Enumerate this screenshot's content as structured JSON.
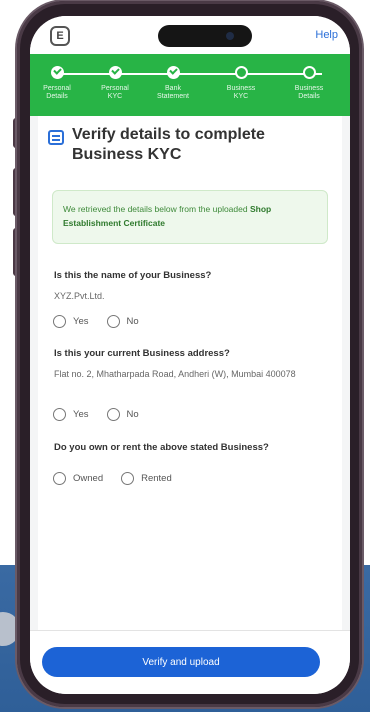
{
  "header": {
    "help_label": "Help",
    "doc_icon": "document-icon"
  },
  "progress": {
    "steps": [
      {
        "label": "Personal\nDetails",
        "status": "done"
      },
      {
        "label": "Personal\nKYC",
        "status": "done"
      },
      {
        "label": "Bank\nStatement",
        "status": "done"
      },
      {
        "label": "Business\nKYC",
        "status": "pending"
      },
      {
        "label": "Business\nDetails",
        "status": "pending"
      }
    ]
  },
  "main": {
    "title": "Verify details to complete Business KYC",
    "info_text": "We retrieved the details below from the uploaded ",
    "info_bold": "Shop Establishment Certificate",
    "questions": [
      {
        "question": "Is this the name of your Business?",
        "answer": "XYZ.Pvt.Ltd.",
        "options": [
          "Yes",
          "No"
        ]
      },
      {
        "question": "Is this your current Business address?",
        "answer": "Flat no. 2, Mhatharpada Road, Andheri (W), Mumbai 400078",
        "options": [
          "Yes",
          "No"
        ]
      },
      {
        "question": "Do you own or rent the above stated Business?",
        "answer": "",
        "options": [
          "Owned",
          "Rented"
        ]
      }
    ]
  },
  "footer": {
    "verify_label": "Verify and upload"
  },
  "colors": {
    "progress_green": "#28b446",
    "primary_blue": "#1c63d6",
    "info_bg": "#eef8ec"
  }
}
